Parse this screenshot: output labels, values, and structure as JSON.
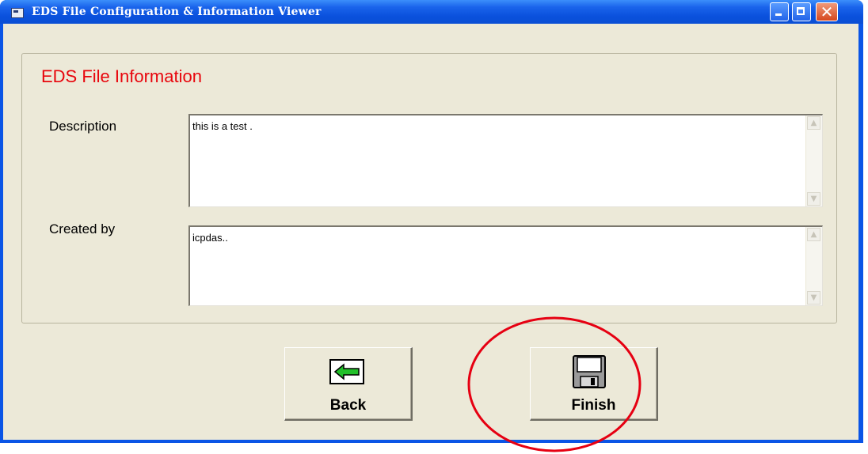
{
  "window": {
    "title": "EDS File Configuration & Information Viewer",
    "title_bar_color": "#0a55e6",
    "controls": {
      "minimize_icon": "minimize-icon",
      "maximize_icon": "maximize-icon",
      "close_icon": "close-icon",
      "close_glyph": "✕"
    }
  },
  "group": {
    "title": "EDS File Information",
    "title_color": "#e8050c"
  },
  "fields": {
    "description": {
      "label": "Description",
      "value": "this is a test ."
    },
    "created_by": {
      "label": "Created by",
      "value": "icpdas.."
    }
  },
  "scrollbar": {
    "up_glyph": "▲",
    "down_glyph": "▼"
  },
  "buttons": {
    "back": {
      "label": "Back",
      "icon": "green-left-arrow-icon"
    },
    "finish": {
      "label": "Finish",
      "icon": "floppy-disk-icon"
    }
  },
  "annotation": {
    "shape": "ellipse",
    "color": "#e60012"
  }
}
